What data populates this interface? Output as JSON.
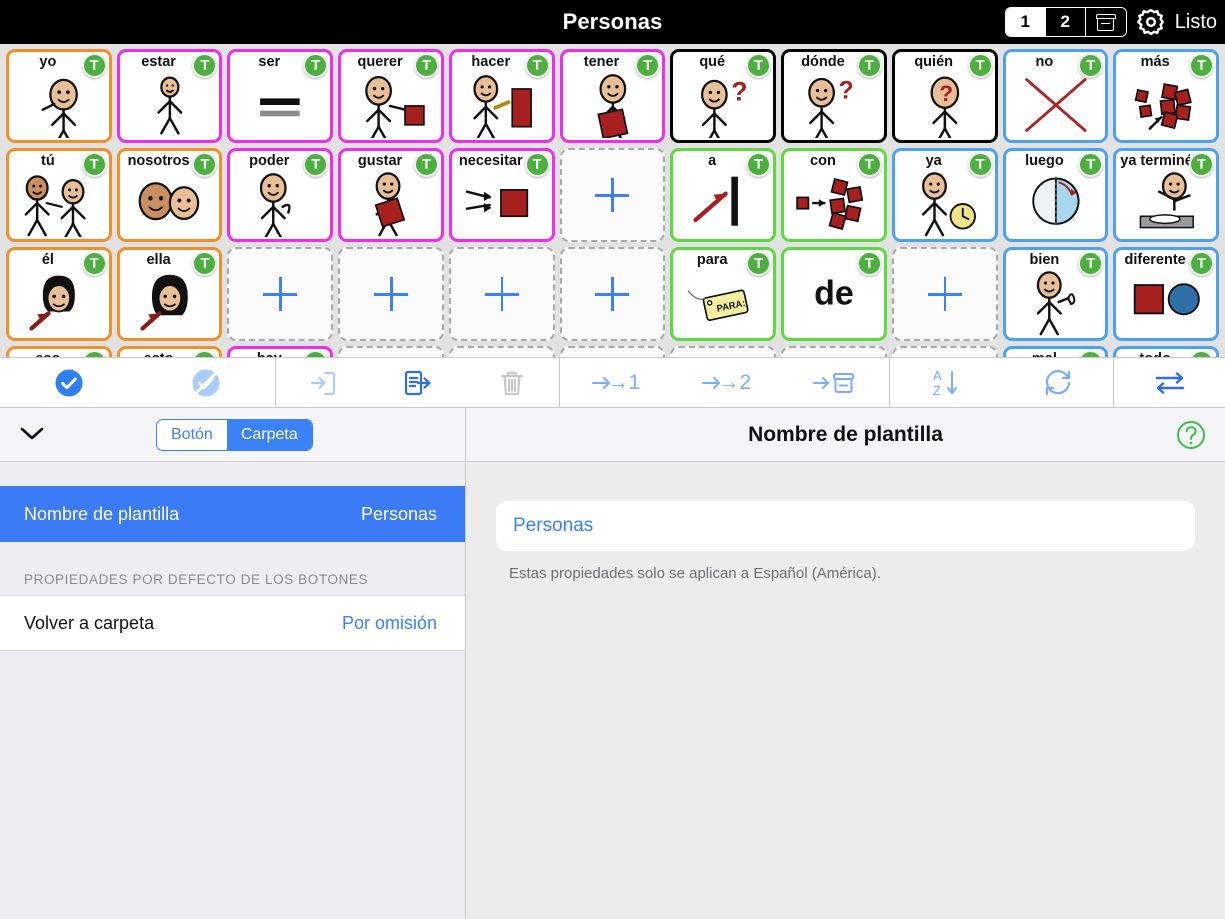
{
  "topbar": {
    "title": "Personas",
    "segments": [
      {
        "label": "1",
        "active": true
      },
      {
        "label": "2",
        "active": false
      },
      {
        "label": "",
        "icon": "archive-box-icon",
        "active": false
      }
    ],
    "gear_icon": "gear-icon",
    "done_label": "Listo"
  },
  "grid": {
    "columns": 11,
    "cells": [
      {
        "label": "yo",
        "border": "#f0902b",
        "art": "person-pointing-self",
        "badge": "T"
      },
      {
        "label": "estar",
        "border": "#ef2ded",
        "art": "person-standing",
        "badge": "T"
      },
      {
        "label": "ser",
        "border": "#ef2ded",
        "art": "equals-bars",
        "badge": "T"
      },
      {
        "label": "querer",
        "border": "#ef2ded",
        "art": "person-reaching-block",
        "badge": "T"
      },
      {
        "label": "hacer",
        "border": "#ef2ded",
        "art": "person-hammer-block",
        "badge": "T"
      },
      {
        "label": "tener",
        "border": "#ef2ded",
        "art": "person-holding-block",
        "badge": "T"
      },
      {
        "label": "qué",
        "border": "#000000",
        "art": "person-question",
        "badge": "T"
      },
      {
        "label": "dónde",
        "border": "#000000",
        "art": "person-looking-question",
        "badge": "T"
      },
      {
        "label": "quién",
        "border": "#000000",
        "art": "person-head-question",
        "badge": "T"
      },
      {
        "label": "no",
        "border": "#4da2f0",
        "art": "red-cross",
        "badge": "T"
      },
      {
        "label": "más",
        "border": "#4da2f0",
        "art": "blocks-more",
        "badge": "T"
      },
      {
        "label": "tú",
        "border": "#f0902b",
        "art": "two-people-pointing",
        "badge": "T"
      },
      {
        "label": "nosotros",
        "border": "#f0902b",
        "art": "two-heads",
        "badge": "T"
      },
      {
        "label": "poder",
        "border": "#ef2ded",
        "art": "person-flexing",
        "badge": "T"
      },
      {
        "label": "gustar",
        "border": "#ef2ded",
        "art": "person-hugging-block",
        "badge": "T"
      },
      {
        "label": "necesitar",
        "border": "#ef2ded",
        "art": "hands-block",
        "badge": "T"
      },
      {
        "label": "",
        "empty": true
      },
      {
        "label": "a",
        "border": "#5ed93f",
        "art": "arrow-to-bar",
        "badge": "T"
      },
      {
        "label": "con",
        "border": "#5ed93f",
        "art": "blocks-with",
        "badge": "T"
      },
      {
        "label": "ya",
        "border": "#4da2f0",
        "art": "person-clock",
        "badge": "T"
      },
      {
        "label": "luego",
        "border": "#4da2f0",
        "art": "clock-half",
        "badge": "T"
      },
      {
        "label": "ya terminé",
        "border": "#4da2f0",
        "art": "person-hands-up-plate",
        "badge": "T"
      },
      {
        "label": "él",
        "border": "#f0902b",
        "art": "head-arrow-male",
        "badge": "T"
      },
      {
        "label": "ella",
        "border": "#f0902b",
        "art": "head-arrow-female",
        "badge": "T"
      },
      {
        "label": "",
        "empty": true
      },
      {
        "label": "",
        "empty": true
      },
      {
        "label": "",
        "empty": true
      },
      {
        "label": "",
        "empty": true
      },
      {
        "label": "para",
        "border": "#5ed93f",
        "art": "tag-para",
        "badge": "T"
      },
      {
        "label": "de",
        "border": "#5ed93f",
        "art": "word-de",
        "badge": "T",
        "bigword": "de"
      },
      {
        "label": "",
        "empty": true
      },
      {
        "label": "bien",
        "border": "#4da2f0",
        "art": "person-thumbs-up",
        "badge": "T"
      },
      {
        "label": "diferente",
        "border": "#4da2f0",
        "art": "square-circle",
        "badge": "T"
      },
      {
        "label": "eso",
        "border": "#f0902b",
        "art": "",
        "badge": "T"
      },
      {
        "label": "esto",
        "border": "#f0902b",
        "art": "",
        "badge": "T"
      },
      {
        "label": "hay",
        "border": "#ef2ded",
        "art": "",
        "badge": "T"
      },
      {
        "label": "",
        "empty": true
      },
      {
        "label": "",
        "empty": true
      },
      {
        "label": "",
        "empty": true
      },
      {
        "label": "",
        "empty": true
      },
      {
        "label": "",
        "empty": true
      },
      {
        "label": "",
        "empty": true
      },
      {
        "label": "mal",
        "border": "#4da2f0",
        "art": "",
        "badge": "T"
      },
      {
        "label": "todo",
        "border": "#4da2f0",
        "art": "",
        "badge": "T"
      }
    ]
  },
  "edit_toolbar": {
    "groups": [
      [
        {
          "name": "select-all-icon",
          "label": "",
          "state": "enabled"
        },
        {
          "name": "deselect-all-icon",
          "label": "",
          "state": "disabled"
        }
      ],
      [
        {
          "name": "paste-into-icon",
          "label": "",
          "state": "disabled"
        },
        {
          "name": "copy-out-icon",
          "label": "",
          "state": "enabled"
        },
        {
          "name": "delete-icon",
          "label": "",
          "state": "disabled"
        }
      ],
      [
        {
          "name": "move-to-page-1-icon",
          "label": "→1",
          "state": "disabled"
        },
        {
          "name": "move-to-page-2-icon",
          "label": "→2",
          "state": "disabled"
        },
        {
          "name": "move-to-archive-icon",
          "label": "→",
          "state": "disabled"
        }
      ],
      [
        {
          "name": "sort-az-icon",
          "label": "",
          "state": "disabled"
        },
        {
          "name": "refresh-icon",
          "label": "",
          "state": "disabled"
        }
      ],
      [
        {
          "name": "swap-icon",
          "label": "",
          "state": "enabled"
        }
      ]
    ]
  },
  "left_pane": {
    "collapse_icon": "chevron-down-icon",
    "tabs": [
      {
        "label": "Botón",
        "active": false
      },
      {
        "label": "Carpeta",
        "active": true
      }
    ],
    "rows": [
      {
        "label": "Nombre de plantilla",
        "value": "Personas",
        "selected": true
      }
    ],
    "section_title": "PROPIEDADES POR DEFECTO DE LOS BOTONES",
    "section_rows": [
      {
        "label": "Volver a carpeta",
        "value": "Por omisión",
        "selected": false
      }
    ]
  },
  "right_pane": {
    "title": "Nombre de plantilla",
    "help_icon": "help-circle-icon",
    "input_value": "Personas",
    "input_placeholder": "Nombre de plantilla",
    "note": "Estas propiedades solo se aplican a Español (América)."
  },
  "colors": {
    "accent_blue": "#3b82f6",
    "topbar_black": "#000000",
    "badge_green": "#4caf3f",
    "grid_bg": "#e2e2e2"
  }
}
